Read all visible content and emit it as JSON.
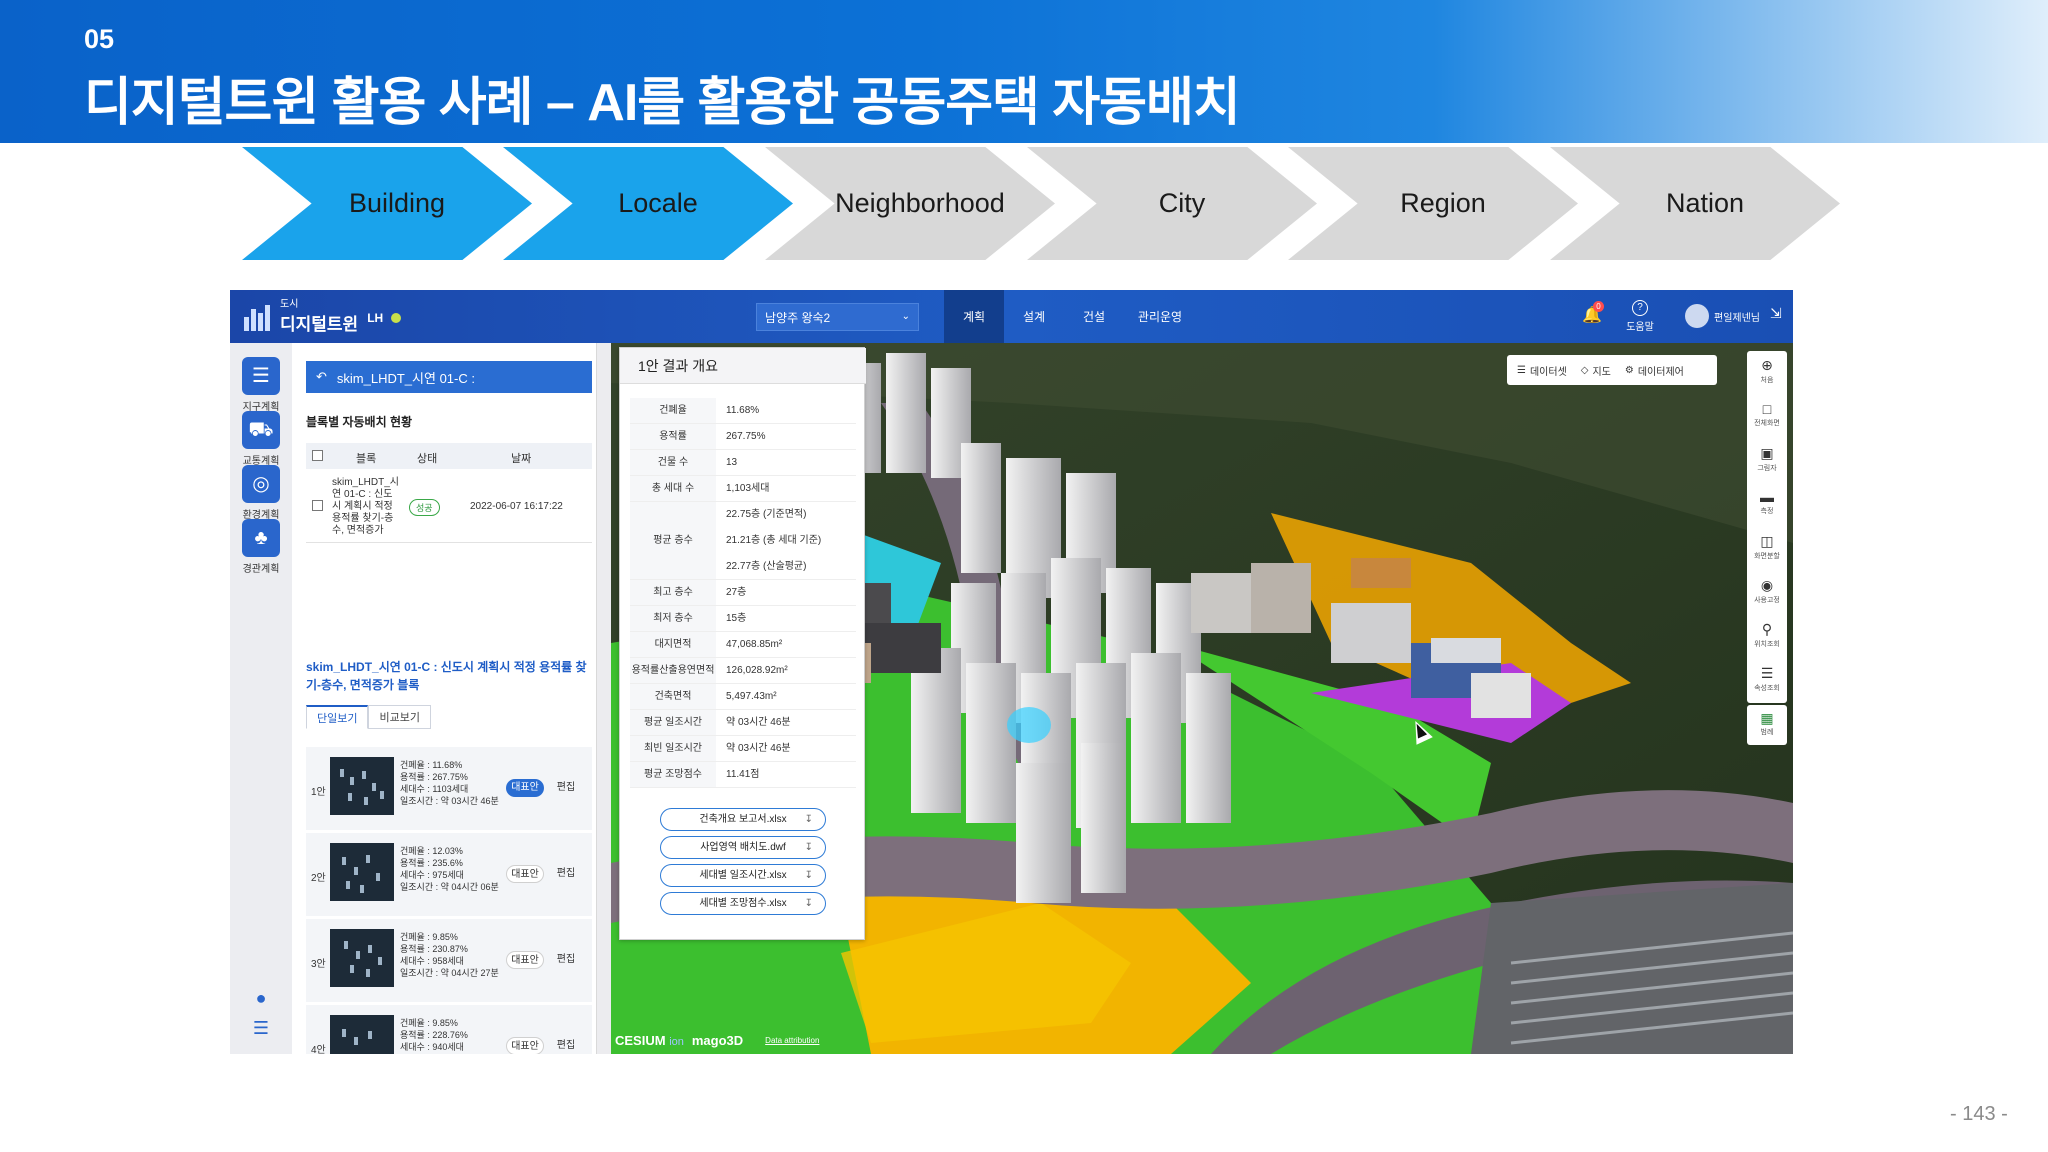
{
  "slide": {
    "section_number": "05",
    "title": "디지털트윈 활용 사례 – AI를 활용한 공동주택 자동배치",
    "page_number": "- 143 -"
  },
  "stages": [
    {
      "label": "Building",
      "active": true
    },
    {
      "label": "Locale",
      "active": true
    },
    {
      "label": "Neighborhood",
      "active": false
    },
    {
      "label": "City",
      "active": false
    },
    {
      "label": "Region",
      "active": false
    },
    {
      "label": "Nation",
      "active": false
    }
  ],
  "app": {
    "logo_small": "도시",
    "logo_main": "디지털트윈",
    "logo_suffix": "LH",
    "region_select": "남양주 왕숙2",
    "nav": [
      "계획",
      "설계",
      "건설",
      "관리운영"
    ],
    "active_nav": "계획",
    "notification_count": "0",
    "help_label": "도움말",
    "user_name": "편일제넨님"
  },
  "rail": {
    "items": [
      "지구계획",
      "교통계획",
      "환경계획",
      "경관계획"
    ]
  },
  "panel": {
    "header": "skim_LHDT_시연 01-C :",
    "subtitle": "블록별 자동배치 현황",
    "columns": [
      "블록",
      "상태",
      "날짜"
    ],
    "row": {
      "name": "skim_LHDT_시연 01-C : 신도시 계획시 적정 용적률 찾기-층수, 면적증가",
      "status": "성공",
      "date": "2022-06-07 16:17:22"
    },
    "block_title": "skim_LHDT_시연 01-C : 신도시 계획시 적정 용적률 찾기-층수, 면적증가 블록",
    "tabs": [
      "단일보기",
      "비교보기"
    ],
    "plans": [
      {
        "no": "1안",
        "lines": [
          "건폐율 : 11.68%",
          "용적률 : 267.75%",
          "세대수 : 1103세대",
          "일조시간 : 약 03시간 46분"
        ],
        "rep": "대표안",
        "rep_active": true,
        "edit": "편집"
      },
      {
        "no": "2안",
        "lines": [
          "건폐율 : 12.03%",
          "용적률 : 235.6%",
          "세대수 : 975세대",
          "일조시간 : 약 04시간 06분"
        ],
        "rep": "대표안",
        "rep_active": false,
        "edit": "편집"
      },
      {
        "no": "3안",
        "lines": [
          "건폐율 : 9.85%",
          "용적률 : 230.87%",
          "세대수 : 958세대",
          "일조시간 : 약 04시간 27분"
        ],
        "rep": "대표안",
        "rep_active": false,
        "edit": "편집"
      },
      {
        "no": "4안",
        "lines": [
          "건폐율 : 9.85%",
          "용적률 : 228.76%",
          "세대수 : 940세대",
          ""
        ],
        "rep": "대표안",
        "rep_active": false,
        "edit": "편집"
      }
    ]
  },
  "result": {
    "title": "1안 결과 개요",
    "rows": [
      {
        "k": "건폐율",
        "v": [
          "11.68%"
        ]
      },
      {
        "k": "용적률",
        "v": [
          "267.75%"
        ]
      },
      {
        "k": "건물 수",
        "v": [
          "13"
        ]
      },
      {
        "k": "총 세대 수",
        "v": [
          "1,103세대"
        ]
      },
      {
        "k": "평균 층수",
        "v": [
          "22.75층 (기준면적)",
          "21.21층 (총 세대 기준)",
          "22.77층 (산술평균)"
        ]
      },
      {
        "k": "최고 층수",
        "v": [
          "27층"
        ]
      },
      {
        "k": "최저 층수",
        "v": [
          "15층"
        ]
      },
      {
        "k": "대지면적",
        "v": [
          "47,068.85m²"
        ]
      },
      {
        "k": "용적률산출용연면적",
        "v": [
          "126,028.92m²"
        ]
      },
      {
        "k": "건축면적",
        "v": [
          "5,497.43m²"
        ]
      },
      {
        "k": "평균 일조시간",
        "v": [
          "약 03시간 46분"
        ]
      },
      {
        "k": "최빈 일조시간",
        "v": [
          "약 03시간 46분"
        ]
      },
      {
        "k": "평균 조망점수",
        "v": [
          "11.41점"
        ]
      }
    ],
    "downloads": [
      "건축개요 보고서.xlsx",
      "사업영역 배치도.dwf",
      "세대별 일조시간.xlsx",
      "세대별 조망점수.xlsx"
    ]
  },
  "map": {
    "toolbar": [
      "데이터셋",
      "지도",
      "데이터제어"
    ],
    "side_tools": [
      "처음",
      "전체화면",
      "그림자",
      "측정",
      "화면분할",
      "사용고정",
      "위치조회",
      "속성조회"
    ],
    "legend": "범례",
    "credit_main": "CESIUM",
    "credit_ion": "ion",
    "credit_mago": "mago3D",
    "credit_attr": "Data attribution"
  }
}
